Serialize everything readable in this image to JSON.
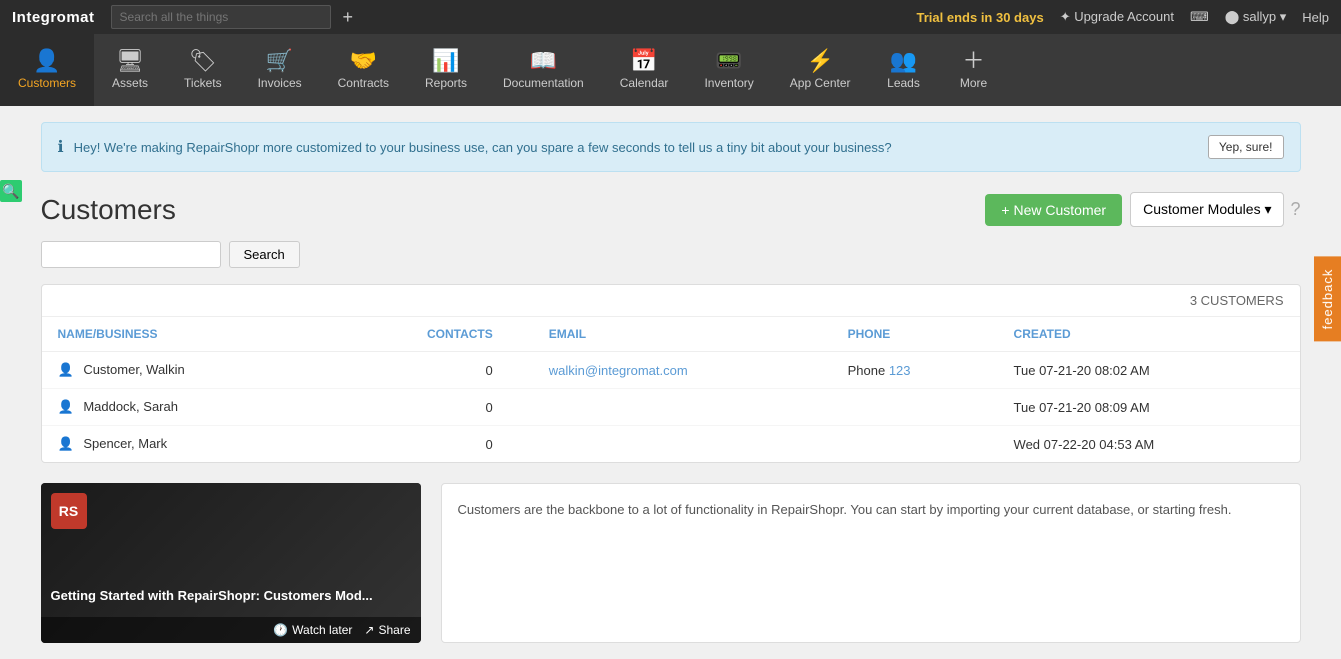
{
  "topbar": {
    "logo": "Integromat",
    "search_placeholder": "Search all the things",
    "plus_label": "+",
    "trial_text": "Trial ends in 30 days",
    "upgrade_label": "✦ Upgrade Account",
    "keyboard_icon": "⌨",
    "user_label": "⬤ sallyp ▾",
    "help_label": "Help"
  },
  "nav": {
    "items": [
      {
        "id": "customers",
        "label": "Customers",
        "icon": "👤",
        "active": true
      },
      {
        "id": "assets",
        "label": "Assets",
        "icon": "🖥"
      },
      {
        "id": "tickets",
        "label": "Tickets",
        "icon": "🏷"
      },
      {
        "id": "invoices",
        "label": "Invoices",
        "icon": "🛒"
      },
      {
        "id": "contracts",
        "label": "Contracts",
        "icon": "🤝"
      },
      {
        "id": "reports",
        "label": "Reports",
        "icon": "📊"
      },
      {
        "id": "documentation",
        "label": "Documentation",
        "icon": "📖"
      },
      {
        "id": "calendar",
        "label": "Calendar",
        "icon": "📅"
      },
      {
        "id": "inventory",
        "label": "Inventory",
        "icon": "📟"
      },
      {
        "id": "appcenter",
        "label": "App Center",
        "icon": "⚡"
      },
      {
        "id": "leads",
        "label": "Leads",
        "icon": "👤+"
      },
      {
        "id": "more",
        "label": "More",
        "icon": "+"
      }
    ]
  },
  "banner": {
    "icon": "ℹ",
    "text": "Hey! We're making RepairShopr more customized to your business use, can you spare a few seconds to tell us a tiny bit about your business?",
    "button_label": "Yep, sure!"
  },
  "customers_page": {
    "title": "Customers",
    "new_customer_label": "+ New Customer",
    "modules_label": "Customer Modules ▾",
    "search_placeholder": "",
    "search_btn": "Search",
    "count": "3 CUSTOMERS",
    "columns": [
      {
        "key": "name",
        "label": "NAME/BUSINESS"
      },
      {
        "key": "contacts",
        "label": "CONTACTS"
      },
      {
        "key": "email",
        "label": "EMAIL"
      },
      {
        "key": "phone",
        "label": "PHONE"
      },
      {
        "key": "created",
        "label": "CREATED"
      }
    ],
    "rows": [
      {
        "name": "Customer, Walkin",
        "contacts": "0",
        "email": "walkin@integromat.com",
        "phone": "Phone 123",
        "phone_number": "123",
        "created": "Tue 07-21-20 08:02 AM"
      },
      {
        "name": "Maddock, Sarah",
        "contacts": "0",
        "email": "",
        "phone": "",
        "created": "Tue 07-21-20 08:09 AM"
      },
      {
        "name": "Spencer, Mark",
        "contacts": "0",
        "email": "",
        "phone": "",
        "created": "Wed 07-22-20 04:53 AM"
      }
    ]
  },
  "video": {
    "logo": "RS",
    "title": "Getting Started with RepairShopr: Customers Mod...",
    "watch_later": "Watch later",
    "share": "Share"
  },
  "text_card": {
    "content": "Customers are the backbone to a lot of functionality in RepairShopr. You can start by importing your current database, or starting fresh."
  },
  "feedback": {
    "label": "feedback"
  }
}
